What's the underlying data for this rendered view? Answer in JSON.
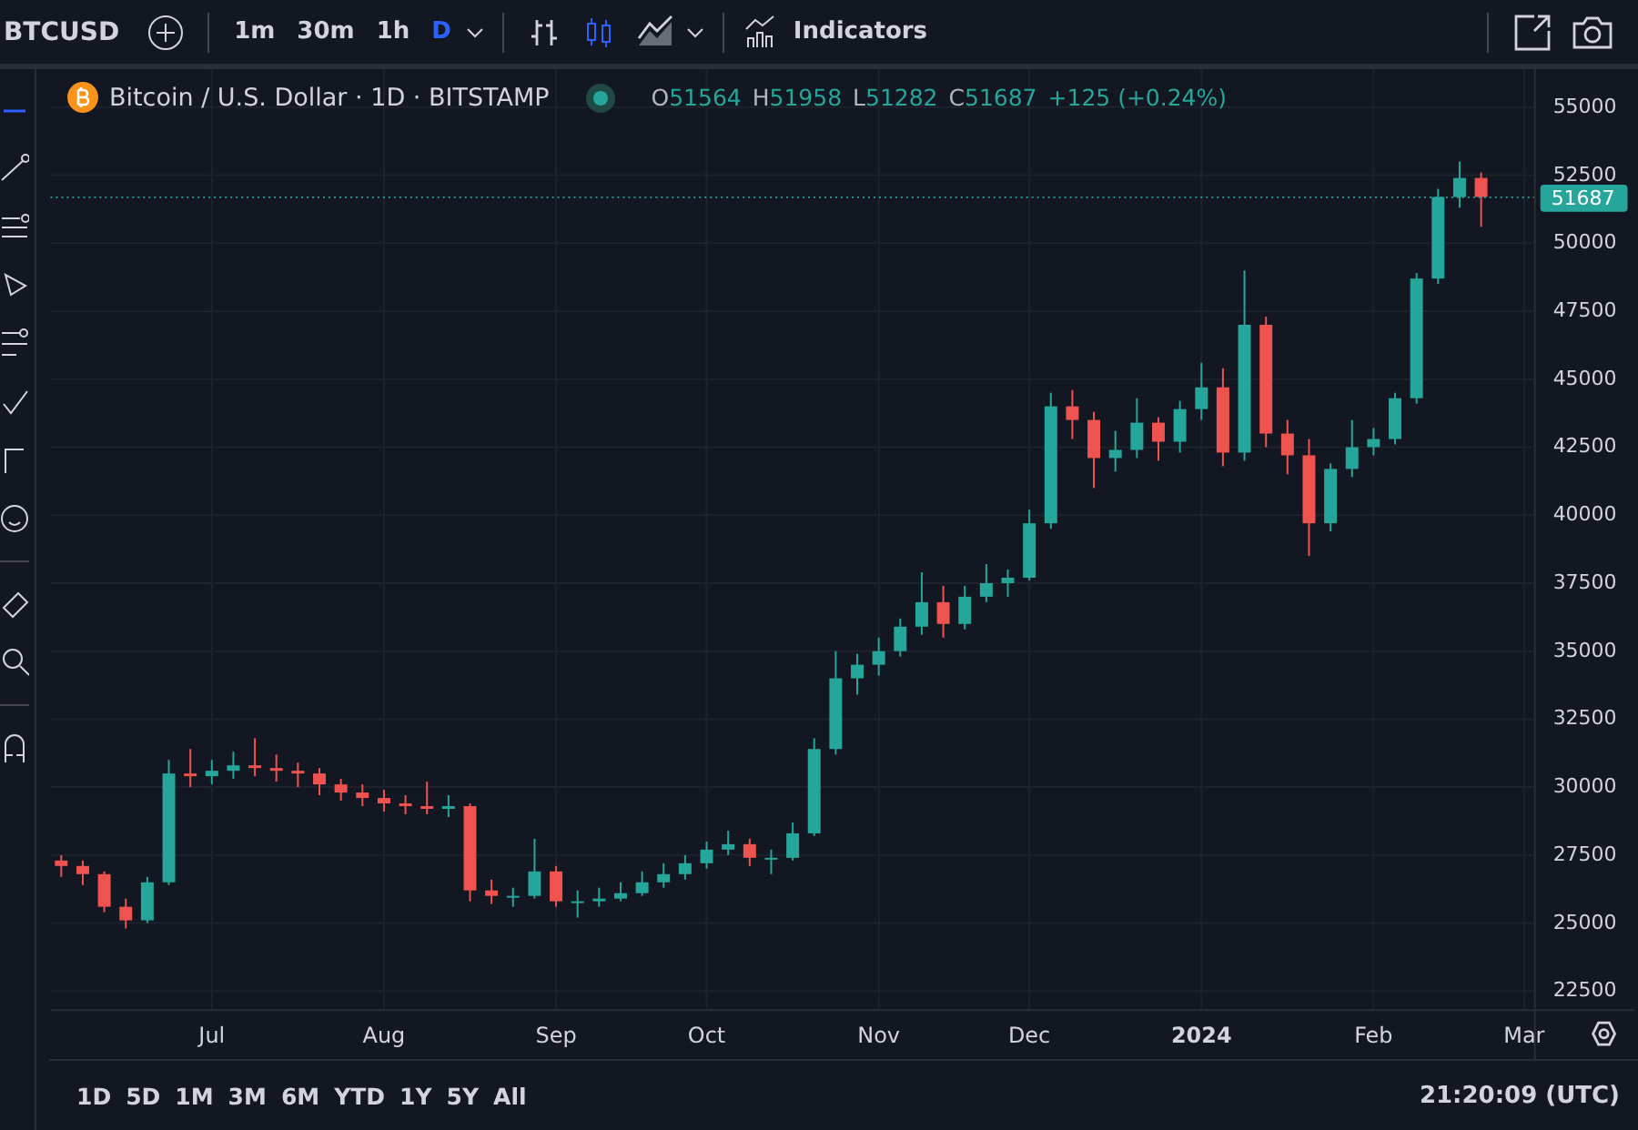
{
  "toolbar": {
    "symbol": "BTCUSD",
    "intervals": [
      {
        "label": "1m",
        "selected": false
      },
      {
        "label": "30m",
        "selected": false
      },
      {
        "label": "1h",
        "selected": false
      },
      {
        "label": "D",
        "selected": true
      }
    ],
    "chart_types": [
      {
        "kind": "bars",
        "selected": false
      },
      {
        "kind": "candles",
        "selected": true
      },
      {
        "kind": "area",
        "selected": false
      }
    ],
    "indicators_label": "Indicators"
  },
  "legend": {
    "title": "Bitcoin / U.S. Dollar · 1D · BITSTAMP",
    "ohlc": [
      {
        "label": "O",
        "value": "51564"
      },
      {
        "label": "H",
        "value": "51958"
      },
      {
        "label": "L",
        "value": "51282"
      },
      {
        "label": "C",
        "value": "51687"
      }
    ],
    "change": "+125 (+0.24%)"
  },
  "chart_data": {
    "type": "candlestick",
    "grid": true,
    "ref_lines": [
      {
        "axis": "y",
        "value": 51687,
        "label": "51687",
        "color": "#26a69a"
      }
    ],
    "categories": [
      null,
      null,
      null,
      null,
      null,
      null,
      null,
      "Jul",
      null,
      null,
      null,
      null,
      null,
      null,
      null,
      "Aug",
      null,
      null,
      null,
      null,
      null,
      null,
      null,
      "Sep",
      null,
      null,
      null,
      null,
      null,
      null,
      "Oct",
      null,
      null,
      null,
      null,
      null,
      null,
      null,
      "Nov",
      null,
      null,
      null,
      null,
      null,
      null,
      "Dec",
      null,
      null,
      null,
      null,
      null,
      null,
      null,
      "2024",
      null,
      null,
      null,
      null,
      null,
      null,
      null,
      "Feb",
      null,
      null,
      null,
      null,
      null,
      null,
      "Mar"
    ],
    "ohlc": [
      [
        27300,
        27500,
        26700,
        27100
      ],
      [
        27100,
        27300,
        26400,
        26800
      ],
      [
        26800,
        26900,
        25400,
        25600
      ],
      [
        25600,
        25900,
        24800,
        25100
      ],
      [
        25100,
        26700,
        25000,
        26500
      ],
      [
        26500,
        31000,
        26400,
        30500
      ],
      [
        30500,
        31400,
        30000,
        30400
      ],
      [
        30400,
        31000,
        30100,
        30600
      ],
      [
        30600,
        31300,
        30300,
        30800
      ],
      [
        30800,
        31800,
        30400,
        30700
      ],
      [
        30700,
        31200,
        30200,
        30600
      ],
      [
        30600,
        30900,
        30000,
        30500
      ],
      [
        30500,
        30700,
        29700,
        30100
      ],
      [
        30100,
        30300,
        29500,
        29800
      ],
      [
        29800,
        30100,
        29300,
        29600
      ],
      [
        29600,
        29900,
        29100,
        29400
      ],
      [
        29400,
        29700,
        29000,
        29300
      ],
      [
        29300,
        30200,
        29000,
        29200
      ],
      [
        29200,
        29700,
        28900,
        29300
      ],
      [
        29300,
        29400,
        25800,
        26200
      ],
      [
        26200,
        26600,
        25700,
        26000
      ],
      [
        26000,
        26300,
        25600,
        26000
      ],
      [
        26000,
        28100,
        25900,
        26900
      ],
      [
        26900,
        27100,
        25600,
        25800
      ],
      [
        25800,
        26200,
        25200,
        25800
      ],
      [
        25800,
        26300,
        25600,
        25900
      ],
      [
        25900,
        26500,
        25800,
        26100
      ],
      [
        26100,
        26900,
        26000,
        26500
      ],
      [
        26500,
        27200,
        26300,
        26800
      ],
      [
        26800,
        27500,
        26600,
        27200
      ],
      [
        27200,
        28000,
        27000,
        27700
      ],
      [
        27700,
        28400,
        27500,
        27900
      ],
      [
        27900,
        28100,
        27100,
        27400
      ],
      [
        27400,
        27700,
        26800,
        27400
      ],
      [
        27400,
        28700,
        27300,
        28300
      ],
      [
        28300,
        31800,
        28200,
        31400
      ],
      [
        31400,
        35000,
        31200,
        34000
      ],
      [
        34000,
        34900,
        33400,
        34500
      ],
      [
        34500,
        35500,
        34100,
        35000
      ],
      [
        35000,
        36200,
        34800,
        35900
      ],
      [
        35900,
        37900,
        35600,
        36800
      ],
      [
        36800,
        37400,
        35500,
        36000
      ],
      [
        36000,
        37400,
        35800,
        37000
      ],
      [
        37000,
        38200,
        36800,
        37500
      ],
      [
        37500,
        38000,
        37000,
        37700
      ],
      [
        37700,
        40200,
        37600,
        39700
      ],
      [
        39700,
        44500,
        39500,
        44000
      ],
      [
        44000,
        44600,
        42800,
        43500
      ],
      [
        43500,
        43800,
        41000,
        42100
      ],
      [
        42100,
        43100,
        41600,
        42400
      ],
      [
        42400,
        44300,
        42100,
        43400
      ],
      [
        43400,
        43600,
        42000,
        42700
      ],
      [
        42700,
        44200,
        42300,
        43900
      ],
      [
        43900,
        45600,
        43500,
        44700
      ],
      [
        44700,
        45400,
        41800,
        42300
      ],
      [
        42300,
        49000,
        42000,
        47000
      ],
      [
        47000,
        47300,
        42500,
        43000
      ],
      [
        43000,
        43500,
        41500,
        42200
      ],
      [
        42200,
        42800,
        38500,
        39700
      ],
      [
        39700,
        41900,
        39400,
        41700
      ],
      [
        41700,
        43500,
        41400,
        42500
      ],
      [
        42500,
        43200,
        42200,
        42800
      ],
      [
        42800,
        44500,
        42600,
        44300
      ],
      [
        44300,
        48900,
        44100,
        48700
      ],
      [
        48700,
        52000,
        48500,
        51700
      ],
      [
        51700,
        53000,
        51300,
        52400
      ],
      [
        52400,
        52600,
        50600,
        51700
      ],
      null,
      null
    ],
    "ylim": [
      21800,
      56400
    ],
    "yticks": [
      22500,
      25000,
      27500,
      30000,
      32500,
      35000,
      37500,
      40000,
      42500,
      45000,
      47500,
      50000,
      52500,
      55000
    ]
  },
  "ranges": [
    "1D",
    "5D",
    "1M",
    "3M",
    "6M",
    "YTD",
    "1Y",
    "5Y",
    "All"
  ],
  "clock": "21:20:09 (UTC)"
}
